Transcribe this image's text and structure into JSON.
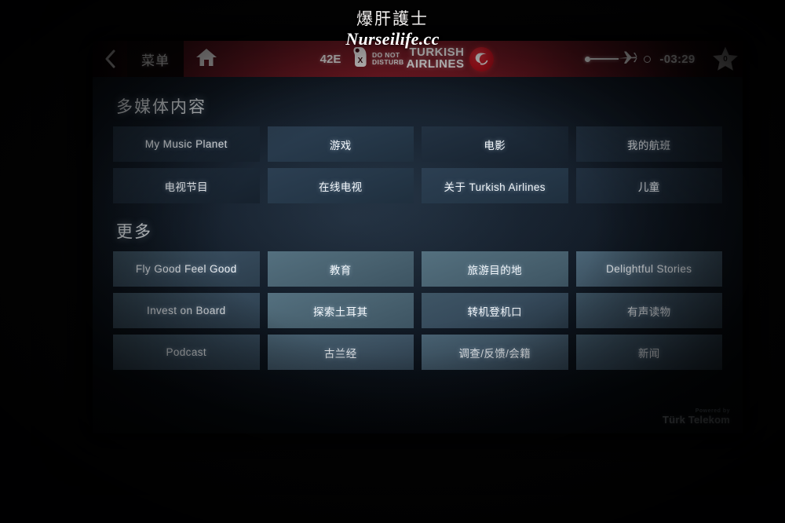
{
  "watermark": {
    "chinese": "爆肝護士",
    "site": "Nurseilife.cc"
  },
  "header": {
    "back_icon": "chevron-left-icon",
    "menu_label": "菜单",
    "home_icon": "home-icon",
    "seat_number": "42E",
    "do_not_disturb": {
      "icon": "door-hanger-icon",
      "line1": "DO NOT",
      "line2": "DISTURB"
    },
    "brand": {
      "line1": "TURKISH",
      "line2": "AIRLINES",
      "roundel_icon": "turkish-airlines-bird-icon",
      "roundel_color": "#c2121f"
    },
    "flight_progress_icon": "airplane-progress-icon",
    "time_remaining": "-03:29",
    "favorites": {
      "icon": "star-icon",
      "count": "0"
    },
    "help_icon": "question-mark-icon",
    "settings_icon": "gear-icon"
  },
  "sections": [
    {
      "title": "多媒体内容",
      "tiles": [
        {
          "label": "My Music Planet",
          "tone": "t-dim"
        },
        {
          "label": "游戏",
          "tone": "t-mid"
        },
        {
          "label": "电影",
          "tone": "t-dim"
        },
        {
          "label": "我的航班",
          "tone": "t-dim"
        },
        {
          "label": "电视节目",
          "tone": "t-dim"
        },
        {
          "label": "在线电视",
          "tone": "t-mid"
        },
        {
          "label": "关于 Turkish Airlines",
          "tone": "t-mid"
        },
        {
          "label": "儿童",
          "tone": "t-dim"
        }
      ]
    },
    {
      "title": "更多",
      "tiles": [
        {
          "label": "Fly Good Feel Good",
          "tone": "t-lite"
        },
        {
          "label": "教育",
          "tone": "t-bright"
        },
        {
          "label": "旅游目的地",
          "tone": "t-bright"
        },
        {
          "label": "Delightful Stories",
          "tone": "t-cool"
        },
        {
          "label": "Invest on Board",
          "tone": "t-lite"
        },
        {
          "label": "探索土耳其",
          "tone": "t-bright"
        },
        {
          "label": "转机登机口",
          "tone": "t-lite"
        },
        {
          "label": "有声读物",
          "tone": "t-lite"
        },
        {
          "label": "Podcast",
          "tone": "t-lite"
        },
        {
          "label": "古兰经",
          "tone": "t-cool"
        },
        {
          "label": "调查/反馈/会籍",
          "tone": "t-cool"
        },
        {
          "label": "新闻",
          "tone": "t-lite"
        }
      ]
    }
  ],
  "footer": {
    "powered_by": "Powered by",
    "provider": "Türk Telekom"
  }
}
